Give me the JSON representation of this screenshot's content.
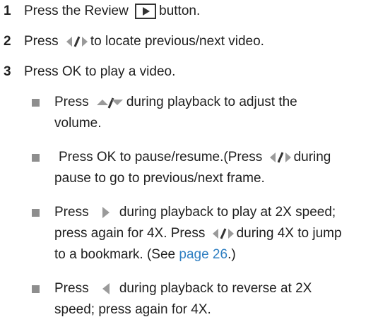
{
  "steps": [
    {
      "num": "1",
      "pre": "Press the Review",
      "post": "button."
    },
    {
      "num": "2",
      "pre": "Press",
      "post": "to locate previous/next video."
    },
    {
      "num": "3",
      "text": "Press OK to play a video."
    }
  ],
  "bullets": {
    "b1": {
      "l1_pre": "Press",
      "l1_post": "during playback to adjust the",
      "l2": "volume."
    },
    "b2": {
      "l1_pre": "Press OK to pause/resume.(Press",
      "l1_post": "during",
      "l2": "pause to go to previous/next frame."
    },
    "b3": {
      "l1_pre": "Press",
      "l1_post": "during playback to play at 2X speed;",
      "l2_pre": "press again for 4X. Press",
      "l2_post": "during 4X to jump",
      "l3_pre": "to a bookmark. (See",
      "l3_link": "page 26",
      "l3_post": ".)"
    },
    "b4": {
      "l1_pre": "Press",
      "l1_post": "during playback to reverse at 2X",
      "l2": "speed; press again for 4X."
    }
  },
  "icons": {
    "review": "review-button-icon",
    "left_right": "left-right-arrow-icon",
    "up_down": "up-down-arrow-icon",
    "right": "right-arrow-icon",
    "left": "left-arrow-icon"
  },
  "colors": {
    "text": "#1f1f1f",
    "link": "#2f7fc2",
    "bullet": "#8e8e8e",
    "icon": "#9a9a9a"
  }
}
